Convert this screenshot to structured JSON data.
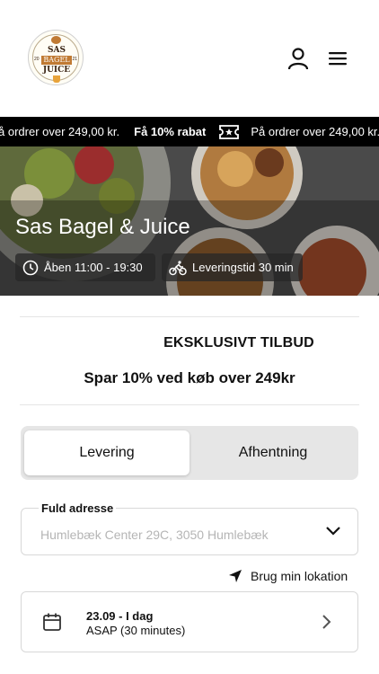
{
  "logo": {
    "line1": "SAS",
    "line2": "BAGEL",
    "line3": "JUICE",
    "left_num": "20",
    "right_num": "21"
  },
  "header": {
    "user_icon": "user-icon",
    "menu_icon": "hamburger-menu-icon"
  },
  "ticker": {
    "text_a": "å ordrer over 249,00 kr.",
    "bold": "Få 10% rabat",
    "icon": "ticket-icon",
    "text_b": "På ordrer over 249,00 kr."
  },
  "hero": {
    "title": "Sas Bagel & Juice",
    "open_label": "Åben 11:00 - 19:30",
    "delivery_label": "Leveringstid 30 min"
  },
  "offer": {
    "title": "EKSKLUSIVT TILBUD",
    "subtitle": "Spar 10% ved køb over 249kr"
  },
  "mode_toggle": {
    "delivery": "Levering",
    "pickup": "Afhentning",
    "selected": "Levering"
  },
  "address": {
    "label": "Fuld adresse",
    "placeholder": "Humlebæk Center 29C, 3050 Humlebæk"
  },
  "locate": {
    "label": "Brug min lokation"
  },
  "schedule": {
    "date": "23.09 - I dag",
    "time": "ASAP (30 minutes)"
  },
  "colors": {
    "ticker_bg": "#000000",
    "toggle_bg": "#e6e6e6",
    "text": "#111111",
    "placeholder": "#b5b5b5"
  }
}
